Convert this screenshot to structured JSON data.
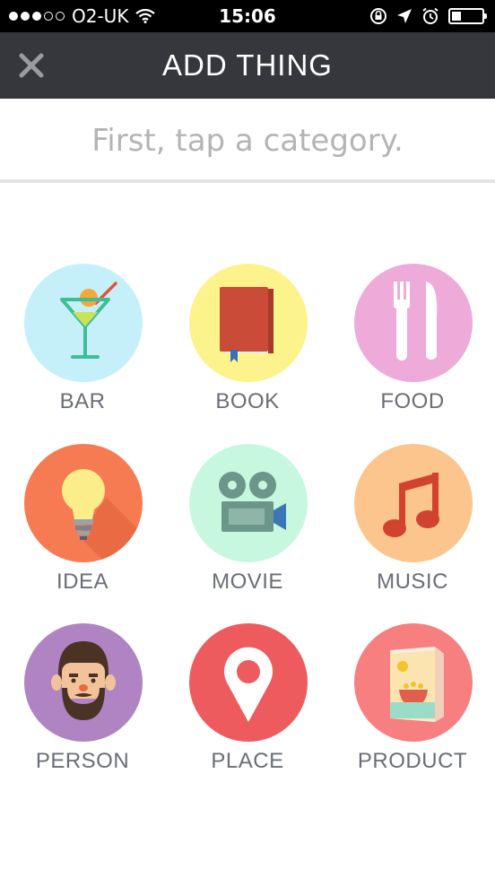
{
  "status": {
    "carrier": "O2-UK",
    "time": "15:06",
    "signal_bars_filled": 3,
    "signal_bars_total": 5
  },
  "header": {
    "title": "ADD THING",
    "close_icon": "close-icon"
  },
  "instruction": "First, tap a category.",
  "categories": [
    {
      "label": "BAR",
      "icon": "cocktail-icon",
      "color": "#c6f0f9"
    },
    {
      "label": "BOOK",
      "icon": "book-icon",
      "color": "#fdf38c"
    },
    {
      "label": "FOOD",
      "icon": "fork-knife-icon",
      "color": "#eeaad9"
    },
    {
      "label": "IDEA",
      "icon": "lightbulb-icon",
      "color": "#f67a52"
    },
    {
      "label": "MOVIE",
      "icon": "movie-camera-icon",
      "color": "#c8f7df"
    },
    {
      "label": "MUSIC",
      "icon": "music-note-icon",
      "color": "#fbc58d"
    },
    {
      "label": "PERSON",
      "icon": "person-face-icon",
      "color": "#b083c2"
    },
    {
      "label": "PLACE",
      "icon": "map-pin-icon",
      "color": "#ee5b5f"
    },
    {
      "label": "PRODUCT",
      "icon": "cereal-box-icon",
      "color": "#f87f7f"
    }
  ],
  "colors": {
    "nav_background": "#36363d",
    "label_text": "#6b6e78",
    "instruction_text": "#b4b4b4"
  }
}
